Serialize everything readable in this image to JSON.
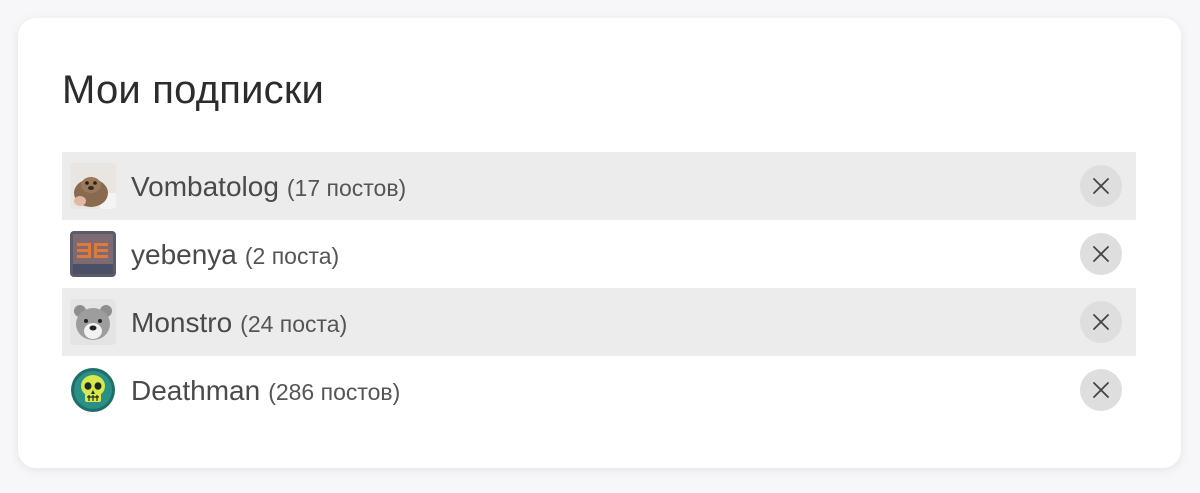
{
  "page": {
    "title": "Мои подписки"
  },
  "subscriptions": [
    {
      "name": "Vombatolog",
      "posts": "(17 постов)",
      "avatar": "wombat-avatar",
      "shaded": true
    },
    {
      "name": "yebenya",
      "posts": "(2 поста)",
      "avatar": "pattern-avatar",
      "shaded": false
    },
    {
      "name": "Monstro",
      "posts": "(24 поста)",
      "avatar": "bear-avatar",
      "shaded": true
    },
    {
      "name": "Deathman",
      "posts": "(286 постов)",
      "avatar": "skull-avatar",
      "shaded": false
    }
  ],
  "icons": {
    "remove": "close-icon"
  },
  "colors": {
    "row_shade": "#ececec",
    "remove_button_bg": "#dedede",
    "text": "#4a4a4a"
  }
}
